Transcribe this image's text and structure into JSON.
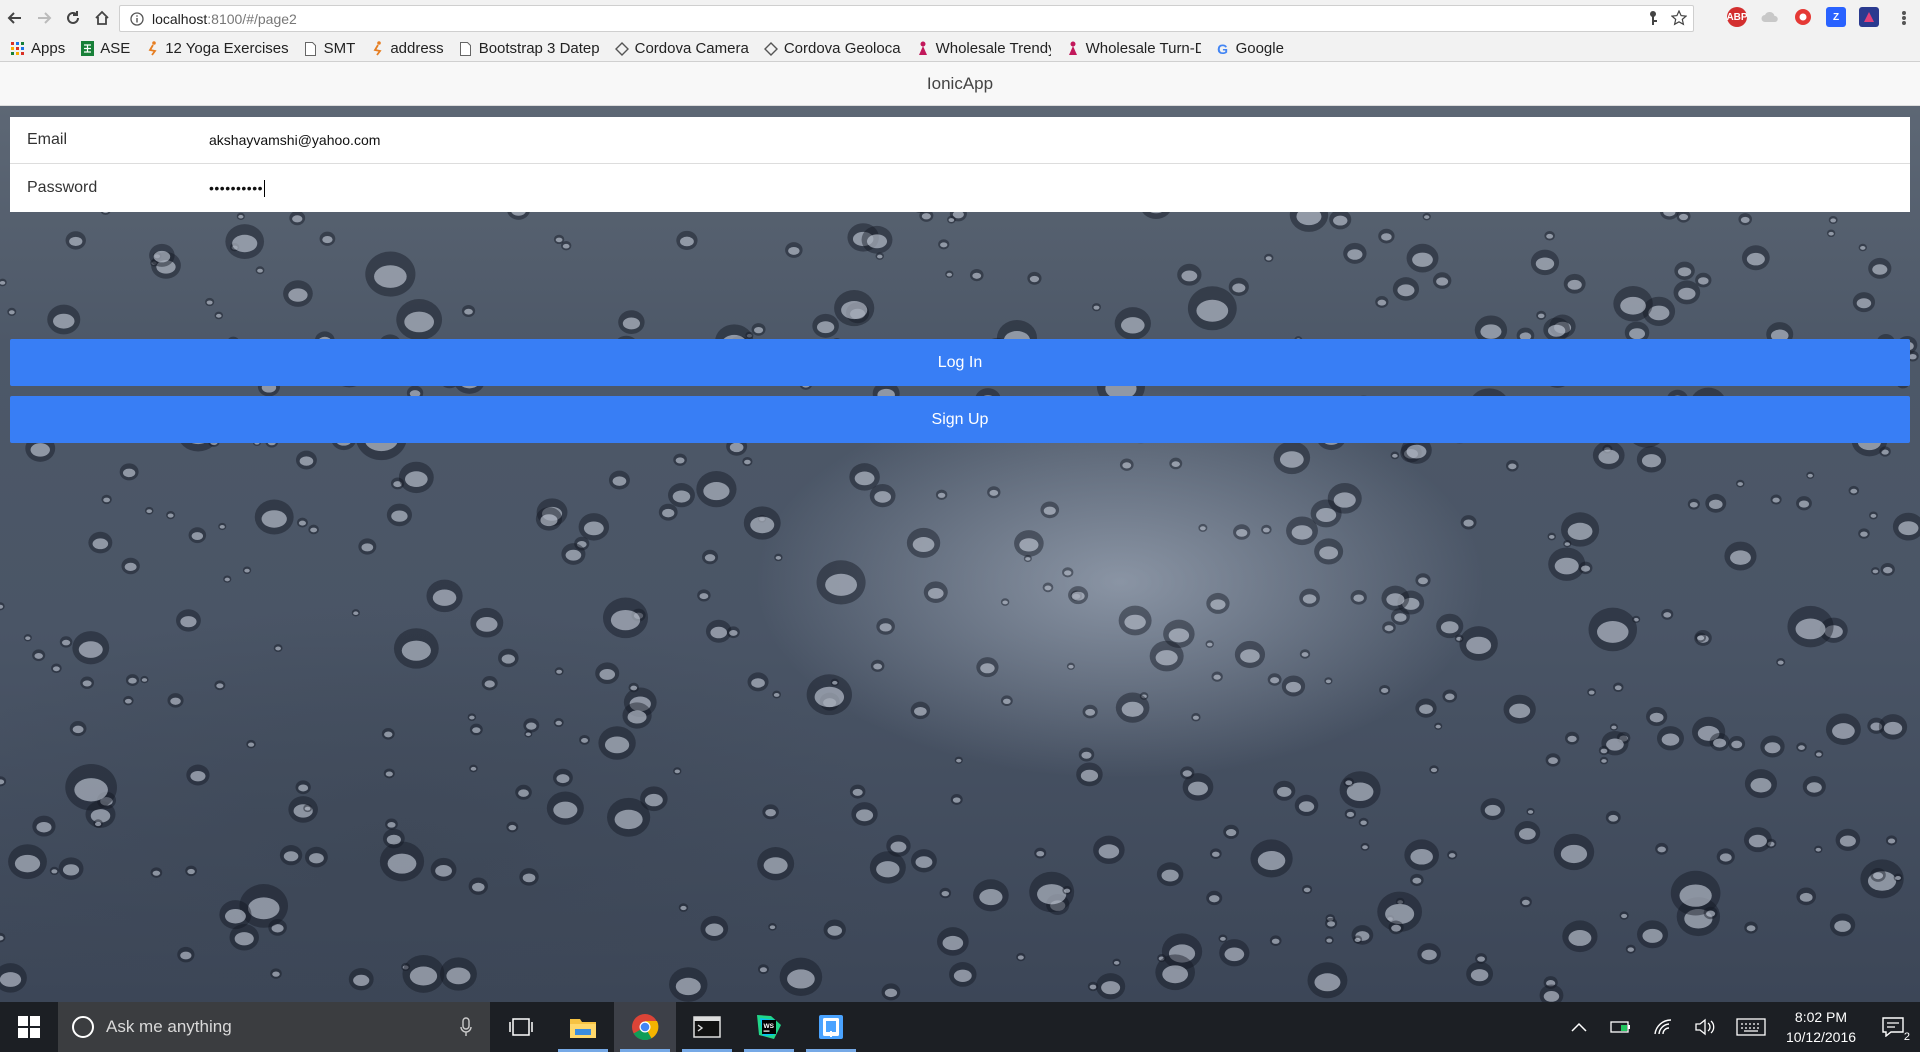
{
  "browser": {
    "url_host": "localhost",
    "url_path": ":8100/#/page2",
    "nav_icons": [
      "back-arrow-icon",
      "forward-arrow-icon",
      "reload-icon",
      "home-icon"
    ],
    "extension_icons": [
      "adblock-icon",
      "cloud-extension-icon",
      "opera-vpn-icon",
      "zotero-icon",
      "extension-icon"
    ]
  },
  "bookmarks": [
    {
      "label": "Apps",
      "icon": "apps-grid-icon"
    },
    {
      "label": "ASE",
      "icon": "sheet-icon"
    },
    {
      "label": "12 Yoga Exercises",
      "icon": "yoga-icon"
    },
    {
      "label": "SMT",
      "icon": "page-icon"
    },
    {
      "label": "address",
      "icon": "yoga-icon"
    },
    {
      "label": "Bootstrap 3 Datep",
      "icon": "page-icon"
    },
    {
      "label": "Cordova Camera",
      "icon": "cordova-icon"
    },
    {
      "label": "Cordova Geoloca",
      "icon": "cordova-icon"
    },
    {
      "label": "Wholesale Trendy",
      "icon": "shop-icon"
    },
    {
      "label": "Wholesale Turn-D",
      "icon": "shop-icon"
    },
    {
      "label": "Google",
      "icon": "google-icon"
    }
  ],
  "app": {
    "title": "IonicApp",
    "email_label": "Email",
    "email_value": "akshayvamshi@yahoo.com",
    "password_label": "Password",
    "password_value": "••••••••••",
    "login_label": "Log In",
    "signup_label": "Sign Up"
  },
  "taskbar": {
    "search_placeholder": "Ask me anything",
    "time": "8:02 PM",
    "date": "10/12/2016",
    "notification_count": "2"
  },
  "colors": {
    "primary_button": "#387ef5",
    "taskbar": "#1c1f24"
  }
}
